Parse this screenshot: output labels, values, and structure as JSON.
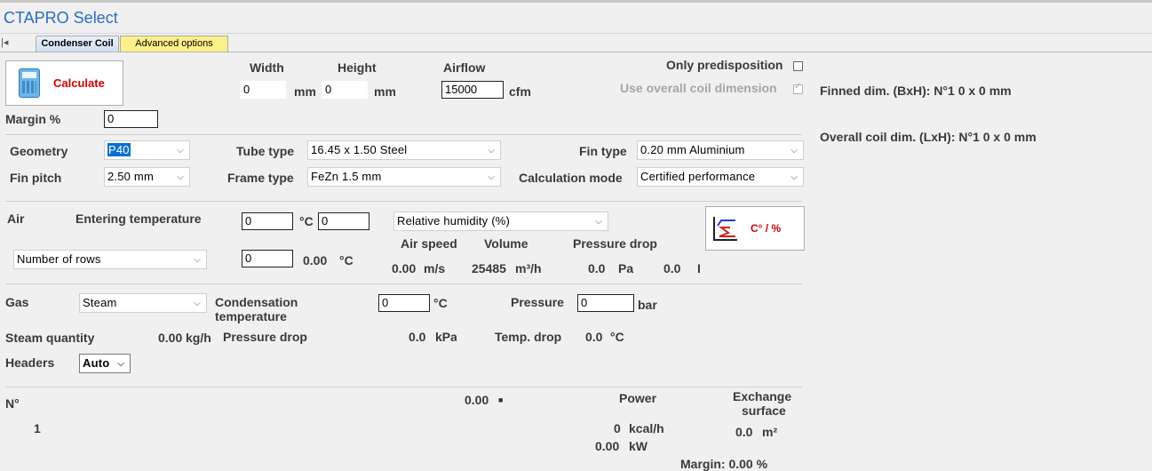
{
  "app": {
    "title": "CTAPRO Select"
  },
  "tabs": [
    {
      "label": "Condenser Coil"
    },
    {
      "label": "Advanced options"
    }
  ],
  "nav_glyph": "|◂",
  "calculate": {
    "label": "Calculate",
    "icon": "calculator-icon"
  },
  "dimensions": {
    "width_label": "Width",
    "width_value": "0",
    "width_unit": "mm",
    "height_label": "Height",
    "height_value": "0",
    "height_unit": "mm",
    "airflow_label": "Airflow",
    "airflow_value": "15000",
    "airflow_unit": "cfm"
  },
  "options": {
    "only_predisposition": "Only predisposition",
    "only_predisposition_checked": false,
    "use_overall": "Use overall coil dimension",
    "use_overall_checked": true
  },
  "summary": {
    "finned": "Finned dim. (BxH): N°1 0 x 0 mm",
    "overall": "Overall coil dim. (LxH): N°1 0 x 0 mm"
  },
  "margin": {
    "label": "Margin %",
    "value": "0"
  },
  "geometry": {
    "label": "Geometry",
    "value": "P40"
  },
  "tube_type": {
    "label": "Tube type",
    "value": "16.45 x 1.50 Steel"
  },
  "fin_type": {
    "label": "Fin type",
    "value": "0.20 mm Aluminium"
  },
  "fin_pitch": {
    "label": "Fin pitch",
    "value": "2.50 mm"
  },
  "frame_type": {
    "label": "Frame type",
    "value": "FeZn 1.5 mm"
  },
  "calc_mode": {
    "label": "Calculation mode",
    "value": "Certified performance"
  },
  "air": {
    "label": "Air",
    "entering_label": "Entering temperature",
    "temp_value": "0",
    "temp_unit": "°C",
    "humidity_value": "0",
    "humidity_select": "Relative humidity (%)",
    "rows_select": "Number of rows",
    "rows_value": "0",
    "leaving_temp": "0.00",
    "leaving_unit": "°C",
    "air_speed_label": "Air speed",
    "air_speed_value": "0.00",
    "air_speed_unit": "m/s",
    "volume_label": "Volume",
    "volume_value": "25485",
    "volume_unit": "m³/h",
    "pressure_drop_label": "Pressure drop",
    "pressure_drop_value": "0.0",
    "pressure_drop_unit": "Pa",
    "pressure_drop_value2": "0.0",
    "pressure_drop_unit2": "I",
    "units_button": "C° / %",
    "units_icon": "temperature-chart-icon"
  },
  "gas": {
    "label": "Gas",
    "select": "Steam",
    "cond_label_1": "Condensation",
    "cond_label_2": "temperature",
    "cond_value": "0",
    "cond_unit": "°C",
    "pressure_label": "Pressure",
    "pressure_value": "0",
    "pressure_unit": "bar",
    "steam_qty_label": "Steam quantity",
    "steam_qty_value": "0.00",
    "steam_qty_unit": "kg/h",
    "pdrop_label": "Pressure drop",
    "pdrop_value": "0.0",
    "pdrop_unit": "kPa",
    "tdrop_label": "Temp. drop",
    "tdrop_value": "0.0",
    "tdrop_unit": "°C",
    "headers_label": "Headers",
    "headers_select": "Auto"
  },
  "results": {
    "n_label": "N°",
    "n_value": "1",
    "mid_value": "0.00",
    "mid_unit": "■",
    "power_label": "Power",
    "power_kcal_value": "0",
    "power_kcal_unit": "kcal/h",
    "power_kw_value": "0.00",
    "power_kw_unit": "kW",
    "exchange_label_1": "Exchange",
    "exchange_label_2": "surface",
    "exchange_value": "0.0",
    "exchange_unit": "m²",
    "margin_text": "Margin: 0.00 %"
  }
}
